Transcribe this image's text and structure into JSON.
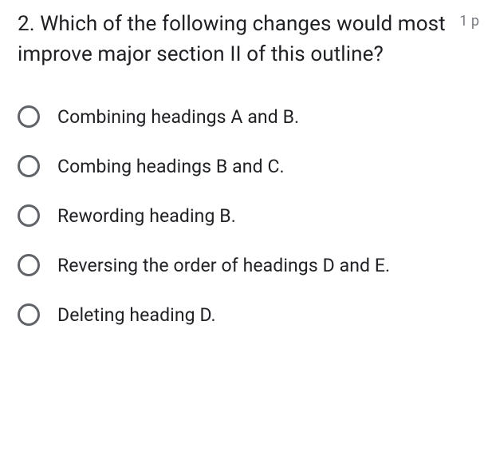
{
  "question": {
    "number_and_text": "2. Which of the following changes would most improve major section II of this outline?",
    "points": "1 p"
  },
  "options": [
    {
      "label": "Combining headings A and B."
    },
    {
      "label": "Combing headings B and C."
    },
    {
      "label": "Rewording heading B."
    },
    {
      "label": "Reversing the order of headings D and E."
    },
    {
      "label": "Deleting heading D."
    }
  ]
}
